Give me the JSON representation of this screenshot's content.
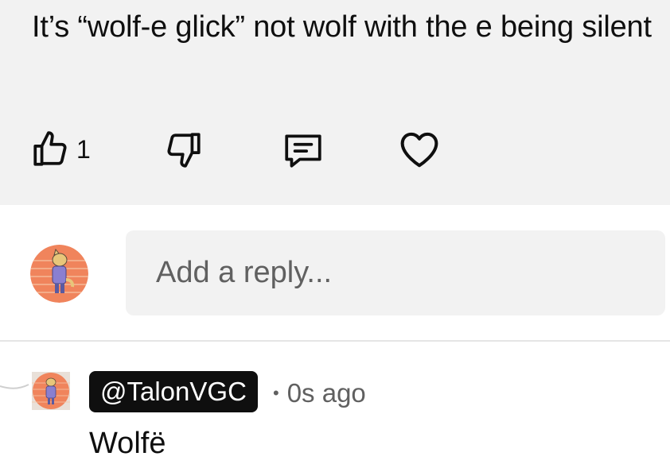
{
  "comment": {
    "text": "It’s “wolf-e glick” not wolf with the e being silent",
    "like_count": "1"
  },
  "actions": {
    "like_icon": "thumbs-up-icon",
    "dislike_icon": "thumbs-down-icon",
    "reply_icon": "comment-icon",
    "heart_icon": "heart-icon"
  },
  "composer": {
    "placeholder": "Add a reply..."
  },
  "reply": {
    "author": "@TalonVGC",
    "separator": "•",
    "time": "0s ago",
    "text": "Wolfë"
  },
  "colors": {
    "highlight_bg": "#f2f2f2",
    "text": "#0f0f0f",
    "secondary_text": "#606060",
    "avatar_bg": "#f0845c",
    "handle_chip_bg": "#0f0f0f"
  }
}
